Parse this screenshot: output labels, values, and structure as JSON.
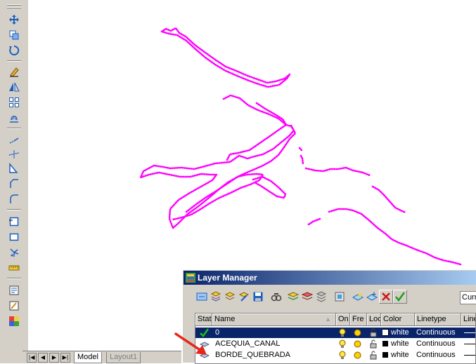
{
  "toolbar": {
    "tools": [
      {
        "name": "move-icon",
        "glyph": "✥"
      },
      {
        "name": "copy-icon",
        "glyph": "copy"
      },
      {
        "name": "rotate-icon",
        "glyph": "rotate"
      },
      {
        "name": "erase-icon",
        "glyph": "erase"
      },
      {
        "name": "mirror-icon",
        "glyph": "mirror"
      },
      {
        "name": "array-icon",
        "glyph": "array"
      },
      {
        "name": "offset-icon",
        "glyph": "offset"
      },
      {
        "name": "extend-icon",
        "glyph": "extend"
      },
      {
        "name": "trim-icon",
        "glyph": "trim"
      },
      {
        "name": "scale-icon",
        "glyph": "scale"
      },
      {
        "name": "chamfer-icon",
        "glyph": "chamfer"
      },
      {
        "name": "fillet-icon",
        "glyph": "fillet"
      },
      {
        "name": "break-icon",
        "glyph": "break"
      },
      {
        "name": "rectangle-icon",
        "glyph": "rect"
      },
      {
        "name": "explode-icon",
        "glyph": "explode"
      },
      {
        "name": "measure-icon",
        "glyph": "measure"
      },
      {
        "name": "properties-icon",
        "glyph": "props"
      },
      {
        "name": "match-properties-icon",
        "glyph": "match"
      },
      {
        "name": "layer-tools-icon",
        "glyph": "layer"
      }
    ]
  },
  "tabs": {
    "model": "Model",
    "layout1": "Layout1"
  },
  "layer_manager": {
    "title": "Layer Manager",
    "current_label": "Curr",
    "columns": {
      "status": "Stat",
      "name": "Name",
      "on": "On",
      "freeze": "Fre",
      "lock": "Loc",
      "color": "Color",
      "linetype": "Linetype",
      "lineweight": "Line"
    },
    "rows": [
      {
        "name": "0",
        "color": "white",
        "linetype": "Continuous",
        "selected": true
      },
      {
        "name": "ACEQUIA_CANAL",
        "color": "white",
        "linetype": "Continuous",
        "selected": false
      },
      {
        "name": "BORDE_QUEBRADA",
        "color": "white",
        "linetype": "Continuous",
        "selected": false
      }
    ]
  },
  "colors": {
    "drawing_line": "#ff00ff",
    "title_bar": "#0a246a",
    "annotation_arrow": "#e8261c",
    "bulb_on": "#ffe640",
    "sun_thawed": "#ffd000"
  }
}
